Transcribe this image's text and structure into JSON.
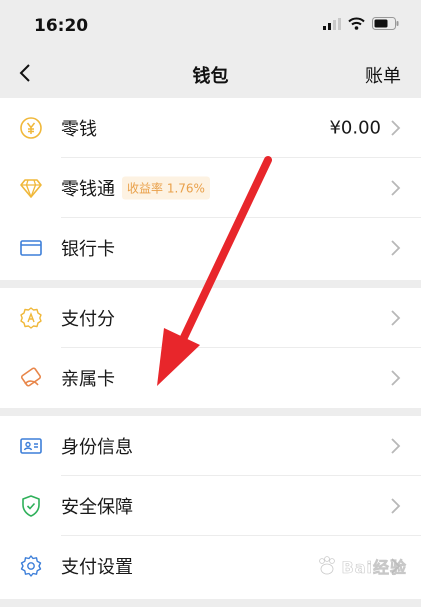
{
  "status_bar": {
    "time": "16:20"
  },
  "nav": {
    "title": "钱包",
    "right_action": "账单"
  },
  "groups": [
    {
      "items": [
        {
          "label": "零钱",
          "value": "¥0.00",
          "icon": "coin-yuan-icon"
        },
        {
          "label": "零钱通",
          "badge": "收益率 1.76%",
          "icon": "diamond-icon"
        },
        {
          "label": "银行卡",
          "icon": "bank-card-icon"
        }
      ]
    },
    {
      "items": [
        {
          "label": "支付分",
          "icon": "score-badge-icon"
        },
        {
          "label": "亲属卡",
          "icon": "family-card-icon"
        }
      ]
    },
    {
      "items": [
        {
          "label": "身份信息",
          "icon": "id-card-icon"
        },
        {
          "label": "安全保障",
          "icon": "shield-check-icon"
        },
        {
          "label": "支付设置",
          "icon": "gear-icon"
        }
      ]
    }
  ],
  "annotation": {
    "icon": "red-arrow-annotation",
    "color": "#e8262b"
  },
  "watermark": {
    "text": "Bai经验",
    "icon": "baidu-paw-icon"
  },
  "colors": {
    "accent_green": "#2fb05a",
    "accent_orange": "#f0b83a",
    "accent_blue": "#3d7fd9",
    "badge_text": "#e9a04a"
  }
}
